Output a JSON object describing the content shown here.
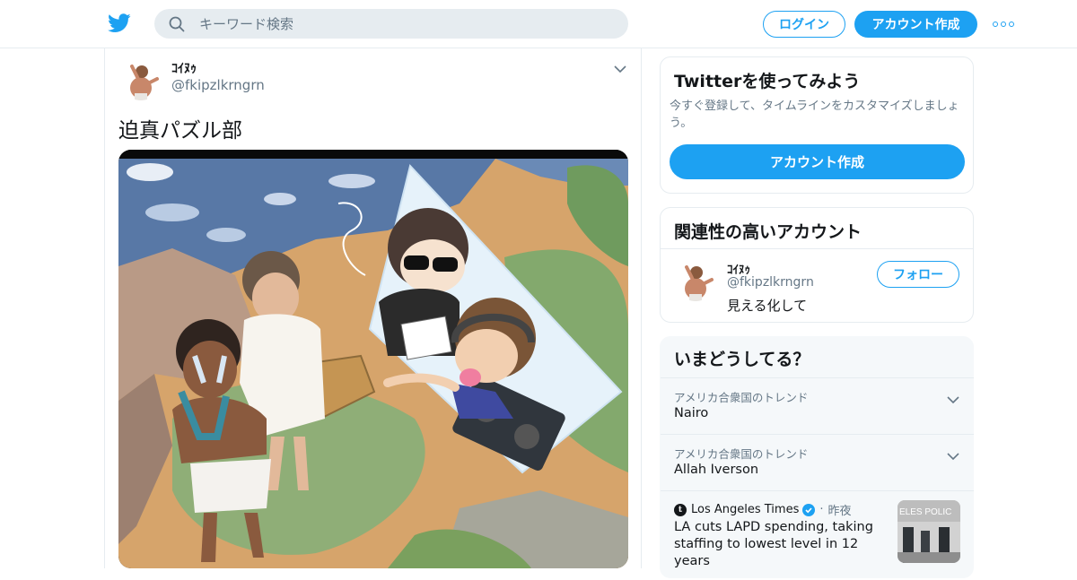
{
  "header": {
    "search_placeholder": "キーワード検索",
    "login_label": "ログイン",
    "signup_label": "アカウント作成"
  },
  "tweet": {
    "display_name": "ｺｲﾇｩ",
    "handle": "@fkipzlkrngrn",
    "text": "迫真パズル部"
  },
  "signup_card": {
    "title": "Twitterを使ってみよう",
    "description": "今すぐ登録して、タイムラインをカスタマイズしましょう。",
    "button_label": "アカウント作成"
  },
  "related_card": {
    "title": "関連性の高いアカウント",
    "account": {
      "display_name": "ｺｲﾇｩ",
      "handle": "@fkipzlkrngrn",
      "bio": "見える化して",
      "follow_label": "フォロー"
    }
  },
  "trends_card": {
    "title": "いまどうしてる？",
    "trends": [
      {
        "context": "アメリカ合衆国のトレンド",
        "name": "Nairo"
      },
      {
        "context": "アメリカ合衆国のトレンド",
        "name": "Allah Iverson"
      }
    ],
    "news": {
      "source": "Los Angeles Times",
      "time": "昨夜",
      "headline": "LA cuts LAPD spending, taking staffing to lowest level in 12 years",
      "thumb_text": "ELES POLIC"
    }
  },
  "colors": {
    "brand_blue": "#1da1f2",
    "border": "#e6ecf0",
    "muted_text": "#657786",
    "trend_bg": "#f5f8fa"
  }
}
